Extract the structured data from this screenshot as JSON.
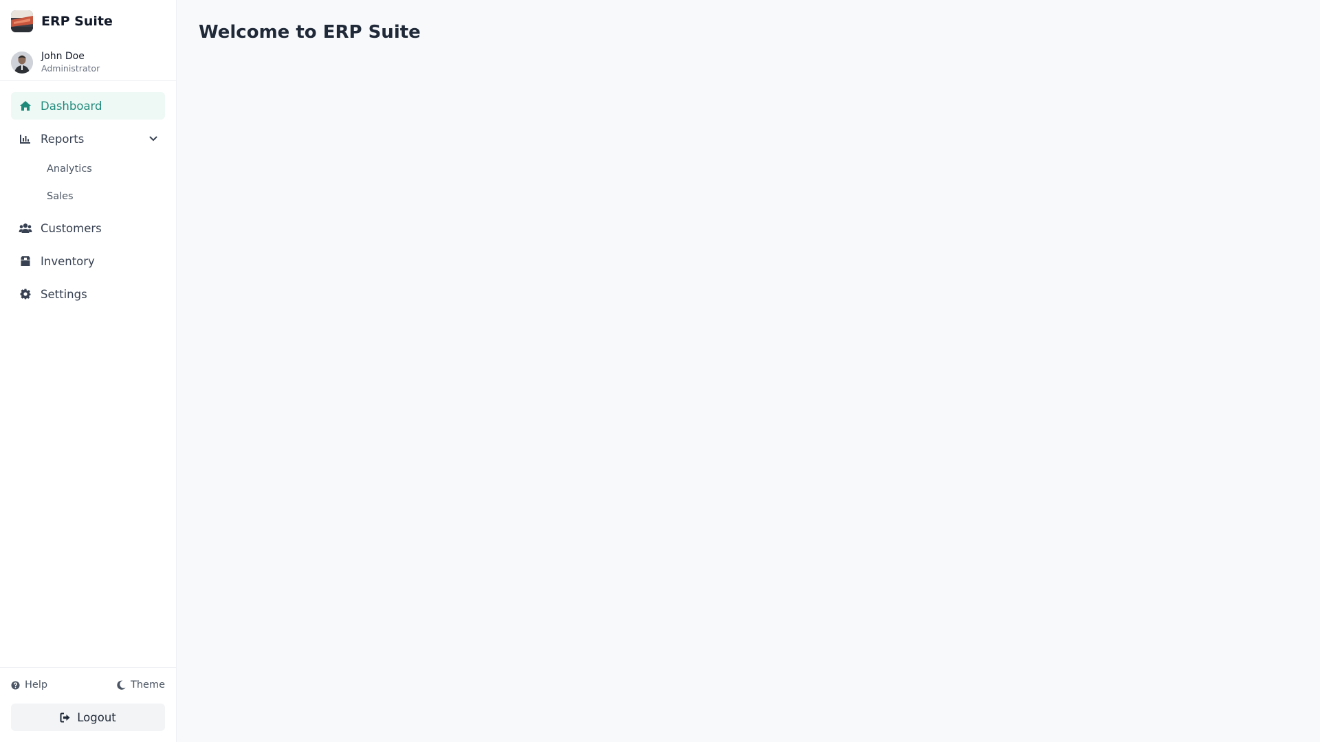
{
  "app": {
    "name": "ERP Suite"
  },
  "user": {
    "name": "John Doe",
    "role": "Administrator"
  },
  "nav": {
    "dashboard": "Dashboard",
    "reports": "Reports",
    "reports_children": {
      "analytics": "Analytics",
      "sales": "Sales"
    },
    "customers": "Customers",
    "inventory": "Inventory",
    "settings": "Settings"
  },
  "footer": {
    "help": "Help",
    "theme": "Theme",
    "logout": "Logout"
  },
  "main": {
    "title": "Welcome to ERP Suite"
  },
  "icons": {
    "dashboard": "home-icon",
    "reports": "bar-chart-icon",
    "customers": "users-icon",
    "inventory": "box-icon",
    "settings": "gear-icon",
    "help": "question-circle-icon",
    "theme": "moon-icon",
    "logout": "sign-out-icon",
    "expand": "chevron-down-icon"
  },
  "colors": {
    "accent": "#1f8a7a",
    "active_bg": "#eef8f5",
    "page_bg": "#f8f9fb"
  }
}
